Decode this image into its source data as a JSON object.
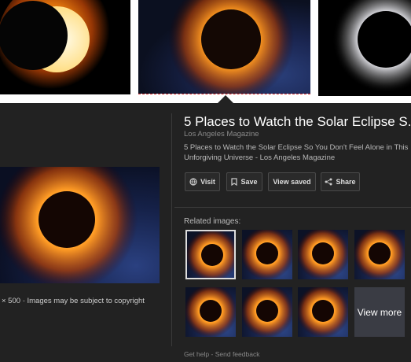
{
  "panel": {
    "title": "5 Places to Watch the Solar Eclipse S...",
    "source": "Los Angeles Magazine",
    "description": "5 Places to Watch the Solar Eclipse So You Don't Feel Alone in This Unforgiving Universe - Los Angeles Magazine",
    "buttons": {
      "visit": "Visit",
      "save": "Save",
      "view_saved": "View saved",
      "share": "Share"
    },
    "caption": {
      "size": "× 500",
      "separator": "-",
      "copyright": "Images may be subject to copyright"
    },
    "related_label": "Related images:",
    "view_more": "View more",
    "footer": {
      "help": "Get help",
      "separator": "-",
      "feedback": "Send feedback"
    }
  },
  "colors": {
    "panel_bg": "#222222",
    "eclipse_glow": "#ff8c1a",
    "selection_line": "#dd3333"
  },
  "icons": [
    "globe-icon",
    "bookmark-icon",
    "share-icon"
  ]
}
